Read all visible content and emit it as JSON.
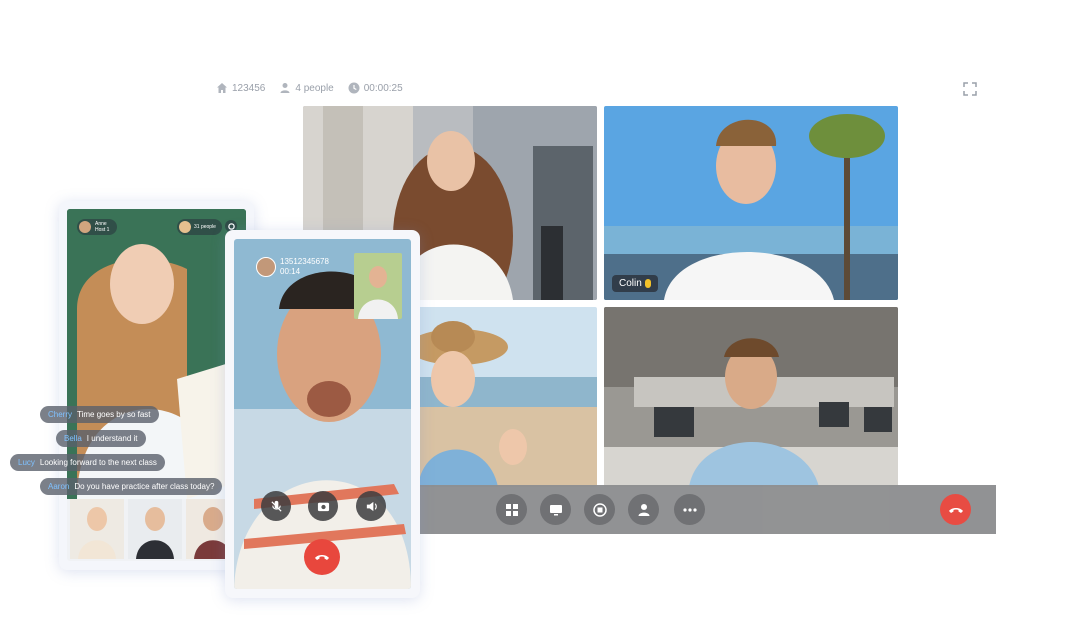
{
  "meta": {
    "room_id": "123456",
    "people": "4 people",
    "duration": "00:00:25"
  },
  "tiles": {
    "colin_label": "Colin"
  },
  "classroom": {
    "host_name": "Anne",
    "host_sub": "Host 1",
    "participants": "31 people",
    "chat": [
      {
        "who": "Cherry",
        "text": "Time goes by so fast"
      },
      {
        "who": "Bella",
        "text": "I understand it"
      },
      {
        "who": "Lucy",
        "text": "Looking forward to the next class"
      },
      {
        "who": "Aaron",
        "text": "Do you have practice after class today?"
      }
    ]
  },
  "call": {
    "number": "13512345678",
    "elapsed": "00:14"
  },
  "colors": {
    "hangup": "#e8473d",
    "control_bar": "#8e8f91",
    "chat_name": "#7fc1ff"
  }
}
